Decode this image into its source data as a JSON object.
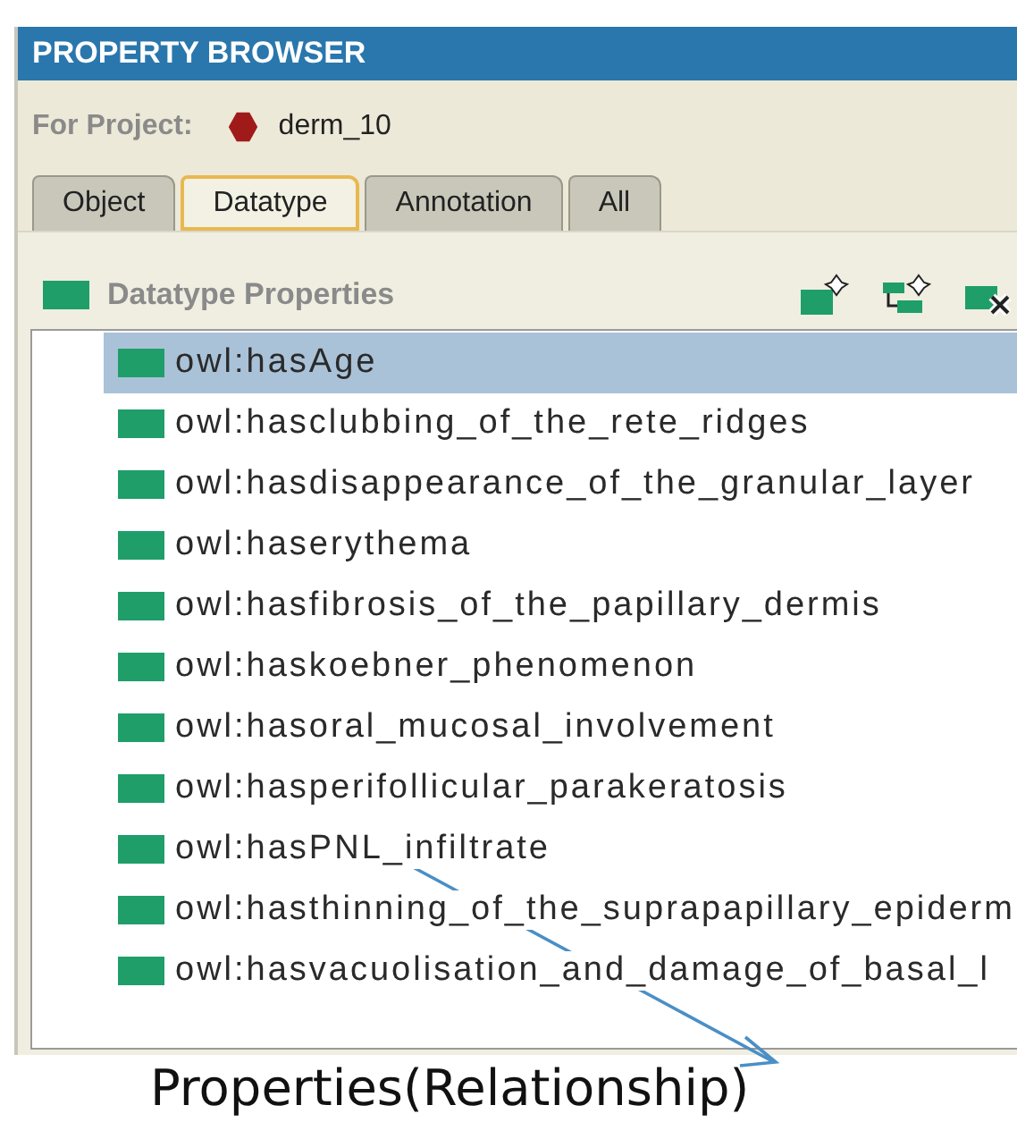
{
  "window": {
    "title": "PROPERTY BROWSER"
  },
  "project": {
    "label": "For Project:",
    "name": "derm_10"
  },
  "tabs": [
    {
      "label": "Object",
      "selected": false
    },
    {
      "label": "Datatype",
      "selected": true
    },
    {
      "label": "Annotation",
      "selected": false
    },
    {
      "label": "All",
      "selected": false
    }
  ],
  "section": {
    "title": "Datatype Properties"
  },
  "properties": [
    {
      "label": "owl:hasAge",
      "selected": true
    },
    {
      "label": "owl:hasclubbing_of_the_rete_ridges",
      "selected": false
    },
    {
      "label": "owl:hasdisappearance_of_the_granular_layer",
      "selected": false
    },
    {
      "label": "owl:haserythema",
      "selected": false
    },
    {
      "label": "owl:hasfibrosis_of_the_papillary_dermis",
      "selected": false
    },
    {
      "label": "owl:haskoebner_phenomenon",
      "selected": false
    },
    {
      "label": "owl:hasoral_mucosal_involvement",
      "selected": false
    },
    {
      "label": "owl:hasperifollicular_parakeratosis",
      "selected": false
    },
    {
      "label": "owl:hasPNL_infiltrate",
      "selected": false
    },
    {
      "label": "owl:hasthinning_of_the_suprapapillary_epiderm",
      "selected": false
    },
    {
      "label": "owl:hasvacuolisation_and_damage_of_basal_l",
      "selected": false
    }
  ],
  "caption": "Properties(Relationship)"
}
